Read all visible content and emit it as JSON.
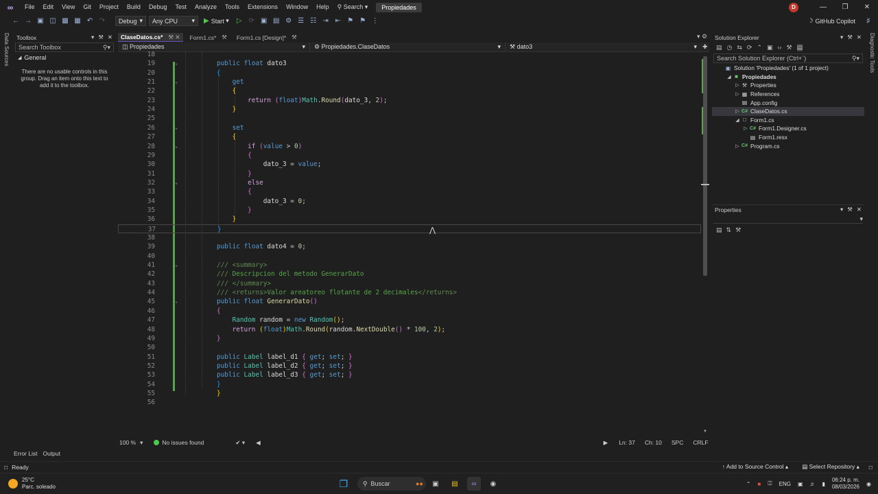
{
  "menu": {
    "items": [
      "File",
      "Edit",
      "View",
      "Git",
      "Project",
      "Build",
      "Debug",
      "Test",
      "Analyze",
      "Tools",
      "Extensions",
      "Window",
      "Help"
    ],
    "search_label": "Search",
    "project_badge": "Propiedades",
    "user_initial": "D"
  },
  "toolbar": {
    "config": "Debug",
    "platform": "Any CPU",
    "start_label": "Start",
    "copilot_label": "GitHub Copilot"
  },
  "left_strip": {
    "label": "Data Sources"
  },
  "right_strip": {
    "label": "Diagnostic Tools"
  },
  "toolbox": {
    "title": "Toolbox",
    "search_placeholder": "Search Toolbox",
    "group": "General",
    "empty_message": "There are no usable controls in this group. Drag an item onto this text to add it to the toolbox."
  },
  "tabs": [
    {
      "label": "ClaseDatos.cs*",
      "active": true
    },
    {
      "label": "Form1.cs*",
      "active": false
    },
    {
      "label": "Form1.cs [Design]*",
      "active": false
    }
  ],
  "navbar": {
    "project": "Propiedades",
    "type": "Propiedades.ClaseDatos",
    "member": "dato3"
  },
  "editor": {
    "lines": [
      {
        "n": "18",
        "html": ""
      },
      {
        "n": "19",
        "html": "<span class='kw'>public</span> <span class='kw'>float</span> <span class='id'>dato3</span>"
      },
      {
        "n": "20",
        "html": "<span class='br3'>{</span>"
      },
      {
        "n": "21",
        "html": "    <span class='kw'>get</span>"
      },
      {
        "n": "22",
        "html": "    <span class='br1'>{</span>"
      },
      {
        "n": "23",
        "html": "        <span class='ct'>return</span> <span class='br2'>(</span><span class='kw'>float</span><span class='br2'>)</span><span class='ty'>Math</span>.<span class='fn'>Round</span><span class='br2'>(</span><span class='id'>dato_3</span>, <span class='nm'>2</span><span class='br2'>)</span>;"
      },
      {
        "n": "24",
        "html": "    <span class='br1'>}</span>"
      },
      {
        "n": "25",
        "html": ""
      },
      {
        "n": "26",
        "html": "    <span class='kw'>set</span>"
      },
      {
        "n": "27",
        "html": "    <span class='br1'>{</span>"
      },
      {
        "n": "28",
        "html": "        <span class='ct'>if</span> <span class='br2'>(</span><span class='kw'>value</span> &gt; <span class='nm'>0</span><span class='br2'>)</span>"
      },
      {
        "n": "29",
        "html": "        <span class='br2'>{</span>"
      },
      {
        "n": "30",
        "html": "            <span class='id'>dato_3</span> = <span class='kw'>value</span>;"
      },
      {
        "n": "31",
        "html": "        <span class='br2'>}</span>"
      },
      {
        "n": "32",
        "html": "        <span class='ct'>else</span>"
      },
      {
        "n": "33",
        "html": "        <span class='br2'>{</span>"
      },
      {
        "n": "34",
        "html": "            <span class='id'>dato_3</span> = <span class='nm'>0</span>;"
      },
      {
        "n": "35",
        "html": "        <span class='br2'>}</span>"
      },
      {
        "n": "36",
        "html": "    <span class='br1'>}</span>"
      },
      {
        "n": "37",
        "html": "<span class='br3'>}</span>"
      },
      {
        "n": "38",
        "html": ""
      },
      {
        "n": "39",
        "html": "<span class='kw'>public</span> <span class='kw'>float</span> <span class='id'>dato4</span> = <span class='nm'>0</span>;"
      },
      {
        "n": "40",
        "html": ""
      },
      {
        "n": "41",
        "html": "<span class='cmg'>///</span> <span class='cmg'>&lt;summary&gt;</span>"
      },
      {
        "n": "42",
        "html": "<span class='cmg'>///</span> <span class='cm'>Descripcion del metodo GenerarDato</span>"
      },
      {
        "n": "43",
        "html": "<span class='cmg'>///</span> <span class='cmg'>&lt;/summary&gt;</span>"
      },
      {
        "n": "44",
        "html": "<span class='cmg'>///</span> <span class='cmg'>&lt;returns&gt;</span><span class='cm'>Valor areatoreo flotante de 2 decimales</span><span class='cmg'>&lt;/returns&gt;</span>"
      },
      {
        "n": "45",
        "html": "<span class='kw'>public</span> <span class='kw'>float</span> <span class='fn'>GenerarDato</span><span class='br2'>()</span>"
      },
      {
        "n": "46",
        "html": "<span class='br2'>{</span>"
      },
      {
        "n": "47",
        "html": "    <span class='ty'>Random</span> <span class='id'>random</span> = <span class='kw'>new</span> <span class='ty'>Random</span><span class='br1'>()</span>;"
      },
      {
        "n": "48",
        "html": "    <span class='ct'>return</span> <span class='br1'>(</span><span class='kw'>float</span><span class='br1'>)</span><span class='ty'>Math</span>.<span class='fn'>Round</span><span class='br1'>(</span><span class='id'>random</span>.<span class='fn'>NextDouble</span><span class='br2'>()</span> * <span class='nm'>100</span>, <span class='nm'>2</span><span class='br1'>)</span>;"
      },
      {
        "n": "49",
        "html": "<span class='br2'>}</span>"
      },
      {
        "n": "50",
        "html": ""
      },
      {
        "n": "51",
        "html": "<span class='kw'>public</span> <span class='ty'>Label</span> <span class='id'>label_d1</span> <span class='br2'>{</span> <span class='kw'>get</span>; <span class='kw'>set</span>; <span class='br2'>}</span>"
      },
      {
        "n": "52",
        "html": "<span class='kw'>public</span> <span class='ty'>Label</span> <span class='id'>label_d2</span> <span class='br2'>{</span> <span class='kw'>get</span>; <span class='kw'>set</span>; <span class='br2'>}</span>"
      },
      {
        "n": "53",
        "html": "<span class='kw'>public</span> <span class='ty'>Label</span> <span class='id'>label_d3</span> <span class='br2'>{</span> <span class='kw'>get</span>; <span class='kw'>set</span>; <span class='br2'>}</span>"
      },
      {
        "n": "54",
        "html": "<span class='br3'>}</span>"
      },
      {
        "n": "55",
        "html": "<span class='br1'>}</span>"
      },
      {
        "n": "56",
        "html": ""
      }
    ]
  },
  "editor_status": {
    "zoom": "100 %",
    "issues": "No issues found",
    "line": "Ln: 37",
    "col": "Ch: 10",
    "whitespace": "SPC",
    "eol": "CRLF"
  },
  "solution_explorer": {
    "title": "Solution Explorer",
    "search_placeholder": "Search Solution Explorer (Ctrl+¨)",
    "items": [
      {
        "label": "Solution 'Propiedades' (1 of 1 project)",
        "depth": 0,
        "expander": "",
        "icon": "▣",
        "icon_color": "#9cb3d6"
      },
      {
        "label": "Propiedades",
        "depth": 1,
        "expander": "◢",
        "icon": "■",
        "icon_color": "#68c96d",
        "bold": true
      },
      {
        "label": "Properties",
        "depth": 2,
        "expander": "▷",
        "icon": "⚒",
        "icon_color": "#cccccc"
      },
      {
        "label": "References",
        "depth": 2,
        "expander": "▷",
        "icon": "▦",
        "icon_color": "#cccccc"
      },
      {
        "label": "App.config",
        "depth": 2,
        "expander": "",
        "icon": "▤",
        "icon_color": "#cccccc"
      },
      {
        "label": "ClaseDatos.cs",
        "depth": 2,
        "expander": "▷",
        "icon": "C#",
        "icon_color": "#68c96d",
        "selected": true
      },
      {
        "label": "Form1.cs",
        "depth": 2,
        "expander": "◢",
        "icon": "□",
        "icon_color": "#cccccc"
      },
      {
        "label": "Form1.Designer.cs",
        "depth": 3,
        "expander": "▷",
        "icon": "C#",
        "icon_color": "#68c96d"
      },
      {
        "label": "Form1.resx",
        "depth": 3,
        "expander": "",
        "icon": "▤",
        "icon_color": "#cccccc"
      },
      {
        "label": "Program.cs",
        "depth": 2,
        "expander": "▷",
        "icon": "C#",
        "icon_color": "#68c96d"
      }
    ]
  },
  "properties": {
    "title": "Properties"
  },
  "bottom_tabs": [
    "Error List",
    "Output"
  ],
  "statusbar": {
    "ready": "Ready",
    "source_control": "Add to Source Control",
    "repository": "Select Repository"
  },
  "taskbar": {
    "temperature": "25°C",
    "weather": "Parc. soleado",
    "search": "Buscar",
    "language": "ENG",
    "time": "06:24 p. m.",
    "date": "08/03/2026"
  },
  "colors": {
    "accent": "#6c4fbf",
    "change_bar": "#57a64a"
  }
}
